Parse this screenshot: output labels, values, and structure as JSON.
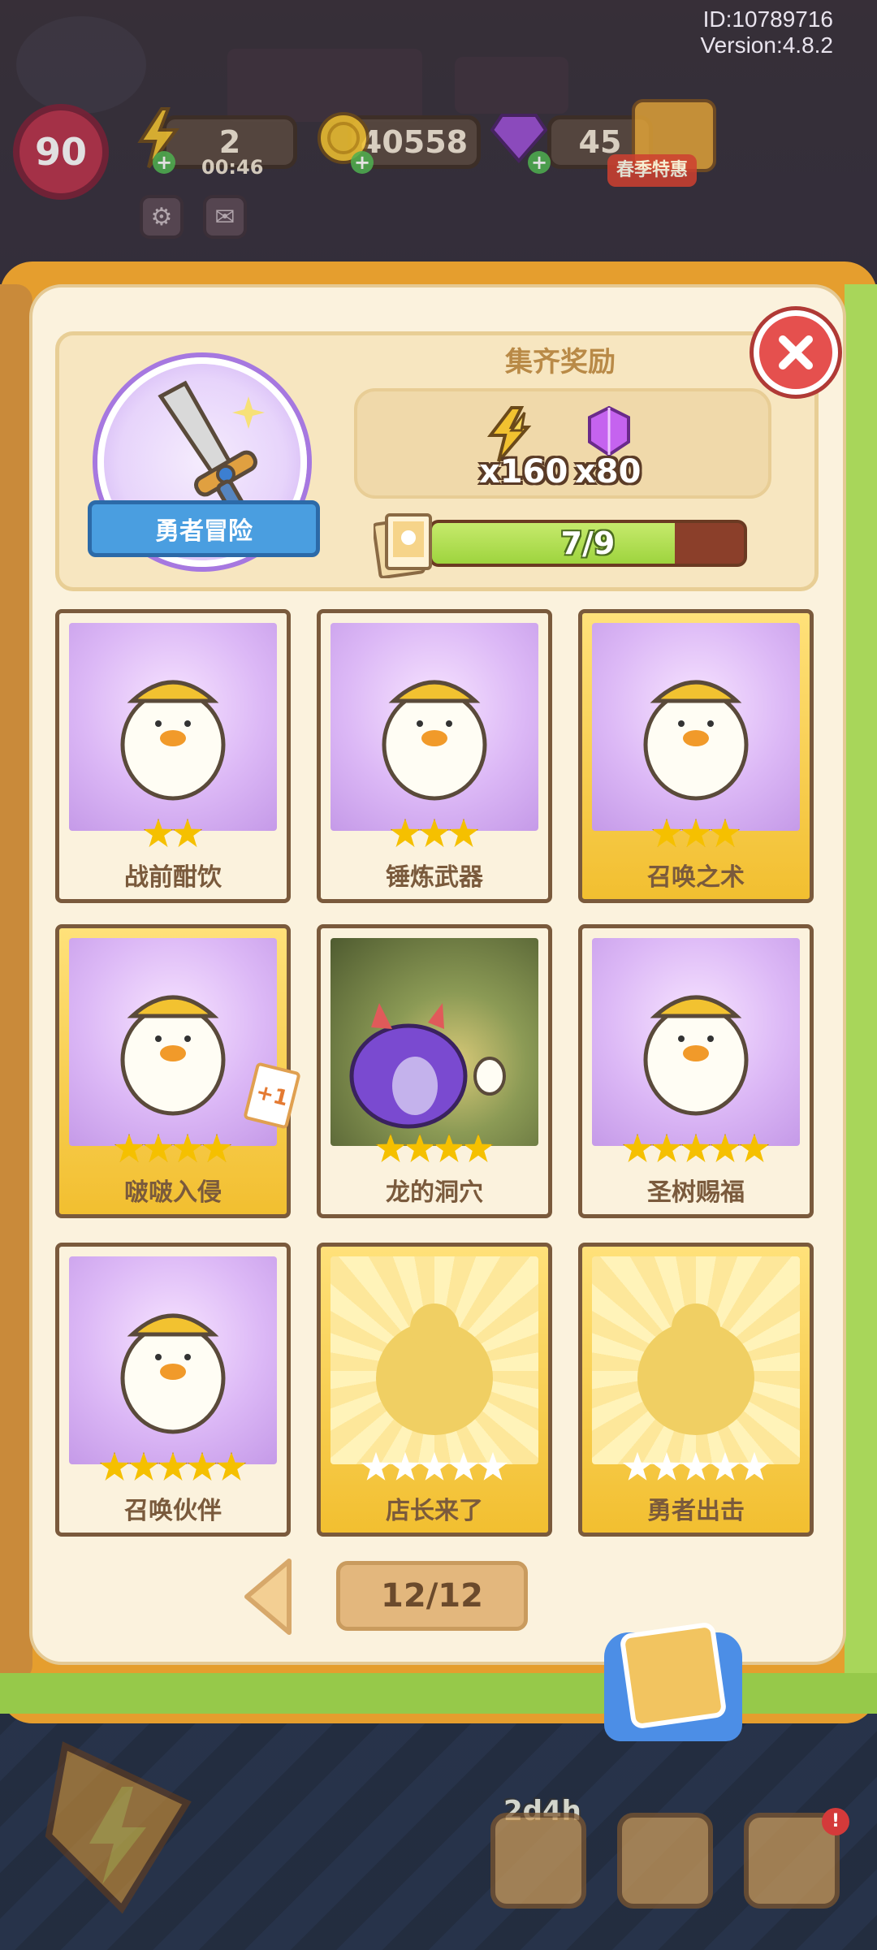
{
  "header": {
    "player_id": "ID:10789716",
    "version": "Version:4.8.2",
    "level": "90",
    "energy": "2",
    "energy_timer": "00:46",
    "coins": "40558",
    "gems": "45",
    "season_label": "春季特惠"
  },
  "album": {
    "collection_name": "勇者冒险",
    "reward_title": "集齐奖励",
    "rewards": [
      {
        "icon": "energy-bolt-icon",
        "qty": "x160"
      },
      {
        "icon": "purple-gem-icon",
        "qty": "x80"
      }
    ],
    "progress_text": "7/9",
    "progress_fraction": 0.778
  },
  "cards": [
    {
      "name": "战前酣饮",
      "stars": 2,
      "max_stars": 2,
      "gold": false,
      "collected": true
    },
    {
      "name": "锤炼武器",
      "stars": 3,
      "max_stars": 3,
      "gold": false,
      "collected": true
    },
    {
      "name": "召唤之术",
      "stars": 3,
      "max_stars": 3,
      "gold": true,
      "collected": true
    },
    {
      "name": "啵啵入侵",
      "stars": 4,
      "max_stars": 4,
      "gold": true,
      "collected": true,
      "extra": "+1"
    },
    {
      "name": "龙的洞穴",
      "stars": 4,
      "max_stars": 4,
      "gold": false,
      "collected": true
    },
    {
      "name": "圣树赐福",
      "stars": 5,
      "max_stars": 5,
      "gold": false,
      "collected": true
    },
    {
      "name": "召唤伙伴",
      "stars": 5,
      "max_stars": 5,
      "gold": false,
      "collected": true
    },
    {
      "name": "店长来了",
      "stars": 0,
      "max_stars": 5,
      "gold": true,
      "collected": false
    },
    {
      "name": "勇者出击",
      "stars": 0,
      "max_stars": 5,
      "gold": true,
      "collected": false
    }
  ],
  "pager": {
    "text": "12/12"
  },
  "bottom": {
    "timer": "2d4h",
    "notice": "!"
  },
  "colors": {
    "accent_gold": "#f2bf30",
    "progress_green": "#9ed43e",
    "close_red": "#e5504e",
    "frame_brown": "#7a5a3c"
  }
}
